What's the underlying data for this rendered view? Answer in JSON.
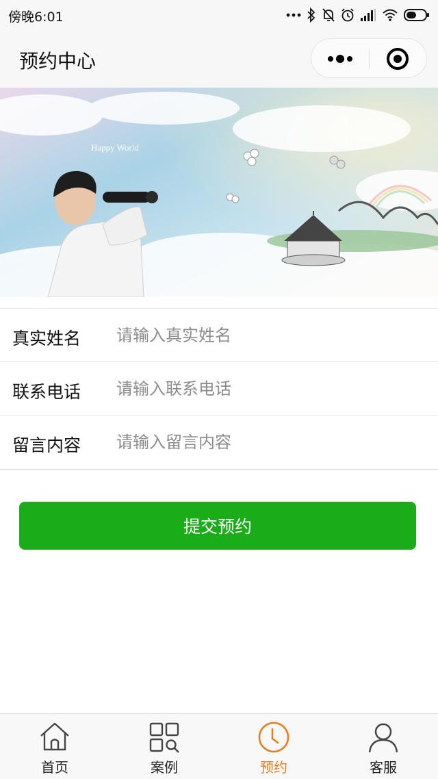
{
  "status_bar": {
    "time": "傍晚6:01",
    "icons": [
      "more-dots-icon",
      "bluetooth-icon",
      "mute-bell-icon",
      "alarm-icon",
      "signal-icon",
      "wifi-icon",
      "battery-icon"
    ]
  },
  "nav": {
    "title": "预约中心",
    "more_icon": "more-dots-icon",
    "close_icon": "target-close-icon"
  },
  "banner": {
    "caption": "Happy World"
  },
  "form": {
    "fields": [
      {
        "label": "真实姓名",
        "placeholder": "请输入真实姓名",
        "value": ""
      },
      {
        "label": "联系电话",
        "placeholder": "请输入联系电话",
        "value": ""
      },
      {
        "label": "留言内容",
        "placeholder": "请输入留言内容",
        "value": ""
      }
    ],
    "submit_label": "提交预约"
  },
  "tabbar": {
    "active_color": "#e67e22",
    "items": [
      {
        "label": "首页",
        "icon": "home-icon",
        "active": false
      },
      {
        "label": "案例",
        "icon": "grid-search-icon",
        "active": false
      },
      {
        "label": "预约",
        "icon": "clock-icon",
        "active": true
      },
      {
        "label": "客服",
        "icon": "user-icon",
        "active": false
      }
    ]
  },
  "colors": {
    "primary_button": "#1aad19",
    "nav_bg": "#f7f7f7",
    "active_tab": "#e67e22"
  }
}
